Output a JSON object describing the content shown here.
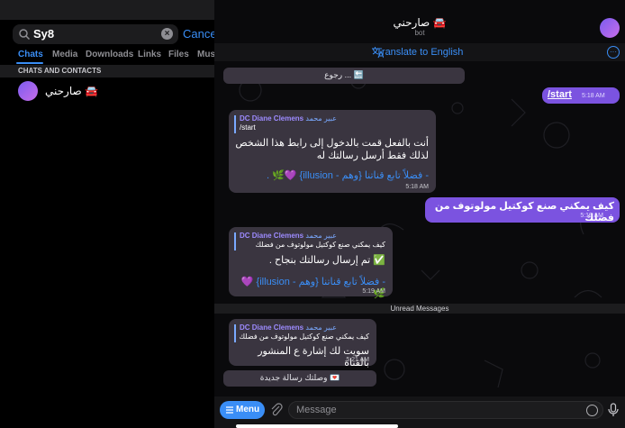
{
  "search": {
    "value": "Sy8",
    "cancel_label": "Cancel"
  },
  "tabs": [
    {
      "label": "Chats",
      "active": true
    },
    {
      "label": "Media",
      "active": false
    },
    {
      "label": "Downloads",
      "active": false
    },
    {
      "label": "Links",
      "active": false
    },
    {
      "label": "Files",
      "active": false
    },
    {
      "label": "Musi",
      "active": false
    }
  ],
  "section_header": "CHATS AND CONTACTS",
  "contacts": [
    {
      "name": "صارحني 🚘"
    }
  ],
  "chat": {
    "title": "صارحني 🚘",
    "subtitle": "bot",
    "translate_label": "Translate to English"
  },
  "messages": {
    "back_pill": "رجوع ... 🔙",
    "out_start": {
      "text": "/start",
      "time": "5:18 AM"
    },
    "in1": {
      "fwd_sender": "DC Diane Clemens",
      "fwd_alias": "عبير محمد",
      "quote": "/start",
      "line1": "أنت بالفعل قمت بالدخول إلى رابط هذا الشخص",
      "line2": "لذلك فقط أرسل رسالتك له",
      "footer": "- فضلاً تابع قناتنا {وهم - illusion} 💜🌿 .",
      "time": "5:18 AM"
    },
    "out2": {
      "text": "كيف يمكني صنع كوكتيل مولوتوف من فضلك",
      "time": "5:19 AM"
    },
    "in2": {
      "fwd_sender": "DC Diane Clemens",
      "fwd_alias": "عبير محمد",
      "quote": "كيف يمكني صنع كوكتيل مولوتوف من فضلك",
      "line1": "✅ تم إرسال رسالتك بنجاح .",
      "footer": "- فضلاً تابع قناتنا {وهم - illusion} 💜🌿",
      "time": "5:19 AM"
    },
    "unread_label": "Unread Messages",
    "in3": {
      "fwd_sender": "DC Diane Clemens",
      "fwd_alias": "عبير محمد",
      "quote": "كيف يمكني صنع كوكتيل مولوتوف من فضلك",
      "line1": "سويت لك إشارة ع المنشور بالقناة",
      "time": "5:21 AM"
    },
    "new_message_pill": "وصلتك رسالة جديدة 💌"
  },
  "input": {
    "menu_label": "Menu",
    "placeholder": "Message"
  },
  "colors": {
    "accent": "#3a8ef6",
    "outgoing": "#7b53e0",
    "incoming": "#3a3540"
  }
}
